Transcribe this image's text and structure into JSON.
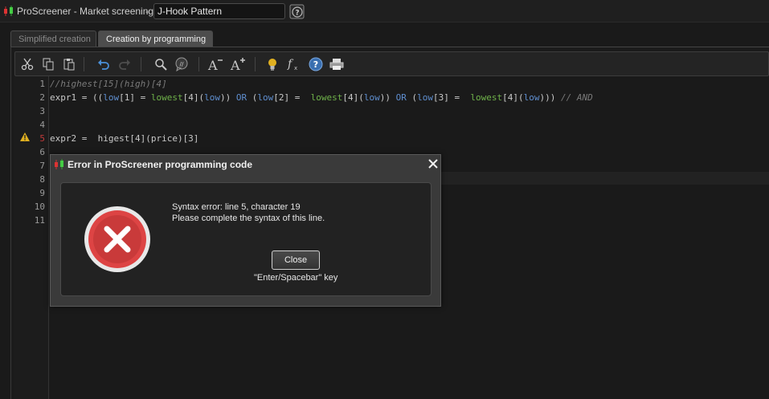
{
  "window": {
    "title": "ProScreener - Market screening",
    "separator": "-",
    "screener_name": "J-Hook Pattern"
  },
  "tabs": [
    {
      "label": "Simplified creation",
      "active": false
    },
    {
      "label": "Creation by programming",
      "active": true
    }
  ],
  "toolbar": {
    "icons": [
      "cut-icon",
      "copy-icon",
      "paste-icon",
      "undo-icon",
      "redo-icon",
      "search-icon",
      "comment-icon",
      "font-decrease-icon",
      "font-increase-icon",
      "idea-icon",
      "function-icon",
      "help-icon",
      "print-icon"
    ]
  },
  "editor": {
    "line_numbers": [
      "1",
      "2",
      "3",
      "4",
      "5",
      "6",
      "7",
      "8",
      "9",
      "10",
      "11"
    ],
    "error_line": "5",
    "lines": {
      "l1": "//highest[15](high)[4]",
      "l2": {
        "p1": "expr1 = ((",
        "p2": "low",
        "p3": "[1] = ",
        "p4": "lowest",
        "p5": "[4](",
        "p6": "low",
        "p7": ")) ",
        "p8": "OR",
        "p9": " (",
        "p10": "low",
        "p11": "[2] =  ",
        "p12": "lowest",
        "p13": "[4](",
        "p14": "low",
        "p15": ")) ",
        "p16": "OR",
        "p17": " (",
        "p18": "low",
        "p19": "[3] =  ",
        "p20": "lowest",
        "p21": "[4](",
        "p22": "low",
        "p23": "))) ",
        "p24": "// AND"
      },
      "l5": "expr2 =  higest[4](price)[3]"
    }
  },
  "dialog": {
    "title": "Error in ProScreener programming code",
    "message_line1": "Syntax error: line 5, character 19",
    "message_line2": "Please complete the syntax of this line.",
    "close_label": "Close",
    "key_hint": "\"Enter/Spacebar\" key"
  },
  "colors": {
    "background": "#1a1a1a",
    "keyword": "#5f8fd0",
    "function": "#6fb24a",
    "comment": "#7a7a7a",
    "error_red": "#c93a3a"
  }
}
